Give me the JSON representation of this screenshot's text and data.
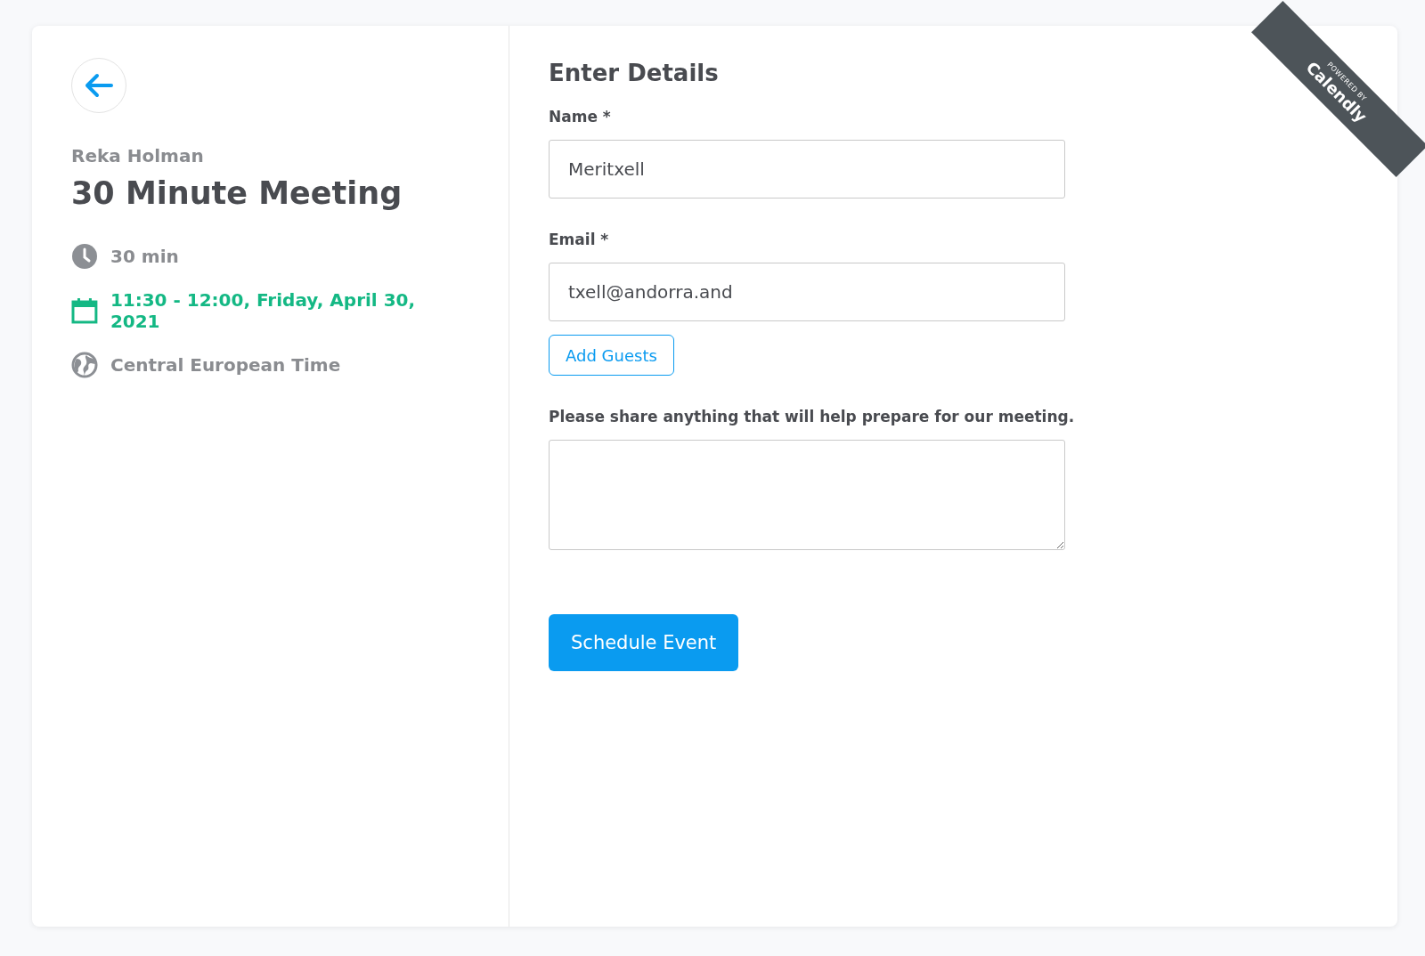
{
  "event": {
    "host": "Reka Holman",
    "title": "30 Minute Meeting",
    "details": [
      {
        "kind": "duration",
        "text": "30 min"
      },
      {
        "kind": "date",
        "text": "11:30 - 12:00, Friday, April 30, 2021"
      },
      {
        "kind": "timezone",
        "text": "Central European Time"
      }
    ]
  },
  "form": {
    "heading": "Enter Details",
    "fields": [
      {
        "kind": "input",
        "label": "Name *",
        "value": "Meritxell"
      },
      {
        "kind": "input",
        "label": "Email *",
        "value": "txell@andorra.and"
      },
      {
        "kind": "button",
        "label": "Add Guests"
      },
      {
        "kind": "textarea",
        "label": "Please share anything that will help prepare for our meeting."
      }
    ],
    "submit": "Schedule Event"
  },
  "ribbon": {
    "caption": "POWERED BY",
    "brand": "Calendly"
  }
}
